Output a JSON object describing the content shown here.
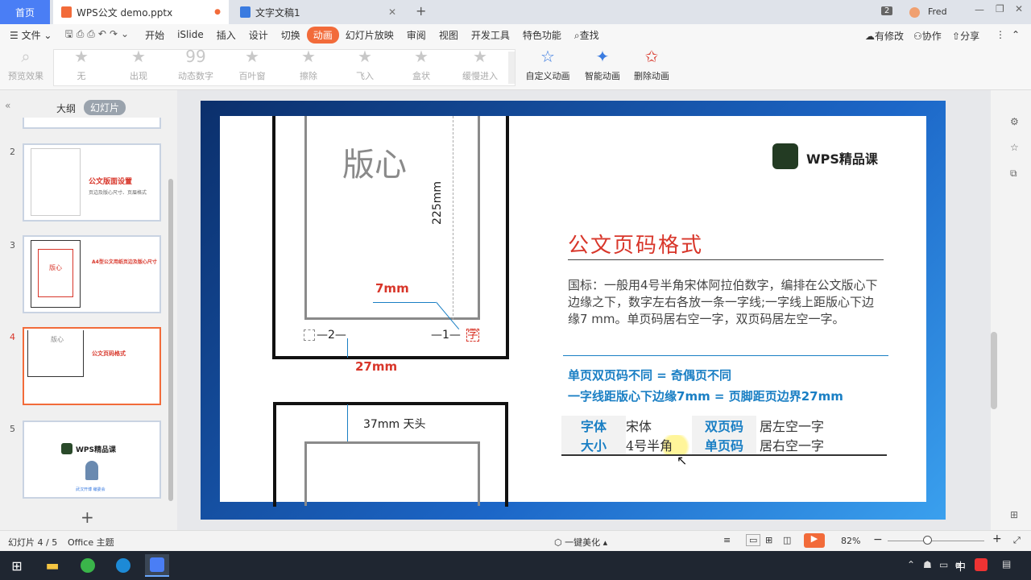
{
  "tabs": {
    "home": "首页",
    "ppt": "WPS公文 demo.pptx",
    "doc": "文字文稿1",
    "count": "2",
    "user": "Fred"
  },
  "menu": {
    "file": "文件",
    "items": [
      "开始",
      "iSlide",
      "插入",
      "设计",
      "切换",
      "动画",
      "幻灯片放映",
      "审阅",
      "视图",
      "开发工具",
      "特色功能"
    ],
    "search": "查找",
    "right": [
      "有修改",
      "协作",
      "分享"
    ]
  },
  "ribbon": {
    "preview": "预览效果",
    "effects": [
      "无",
      "出现",
      "动态数字",
      "百叶窗",
      "擦除",
      "飞入",
      "盒状",
      "缓慢进入"
    ],
    "tools": [
      "自定义动画",
      "智能动画",
      "删除动画"
    ]
  },
  "leftpanel": {
    "tab_outline": "大纲",
    "tab_slides": "幻灯片",
    "thumbs": [
      "2",
      "3",
      "4",
      "5"
    ],
    "t2_title": "公文版面设置",
    "t2_sub": "页边及版心尺寸、页眉格式",
    "t3_title": "A4型公文用纸页边及版心尺寸",
    "t3_label": "版心",
    "t4_label": "版心",
    "t4_title": "公文页码格式",
    "t5_logo": "WPS精品课",
    "t5_caption": "武汉开博 编委会"
  },
  "slide": {
    "banxin": "版心",
    "dim225": "225mm",
    "dim7": "7mm",
    "dim27": "27mm",
    "dim37": "37mm 天头",
    "page_left": "—2—",
    "page_right": "—1—",
    "zi": "字",
    "logo": "WPS精品课",
    "title": "公文页码格式",
    "body": "国标：一般用4号半角宋体阿拉伯数字，编排在公文版心下边缘之下，数字左右各放一条一字线;一字线上距版心下边缘7 mm。单页码居右空一字，双页码居左空一字。",
    "rule1": "单页双页码不同 = 奇偶页不同",
    "rule2": "一字线距版心下边缘7mm = 页脚距页边界27mm",
    "table": [
      [
        "字体",
        "宋体",
        "双页码",
        "居左空一字"
      ],
      [
        "大小",
        "4号半角",
        "单页码",
        "居右空一字"
      ]
    ]
  },
  "status": {
    "slide": "幻灯片 4 / 5",
    "theme": "Office 主题",
    "beautify": "一键美化",
    "zoom": "82%"
  },
  "taskbar": {
    "ime": "中"
  },
  "colors": {
    "accent": "#f26b3a",
    "link": "#1a7fc4",
    "title_red": "#d8362a"
  }
}
